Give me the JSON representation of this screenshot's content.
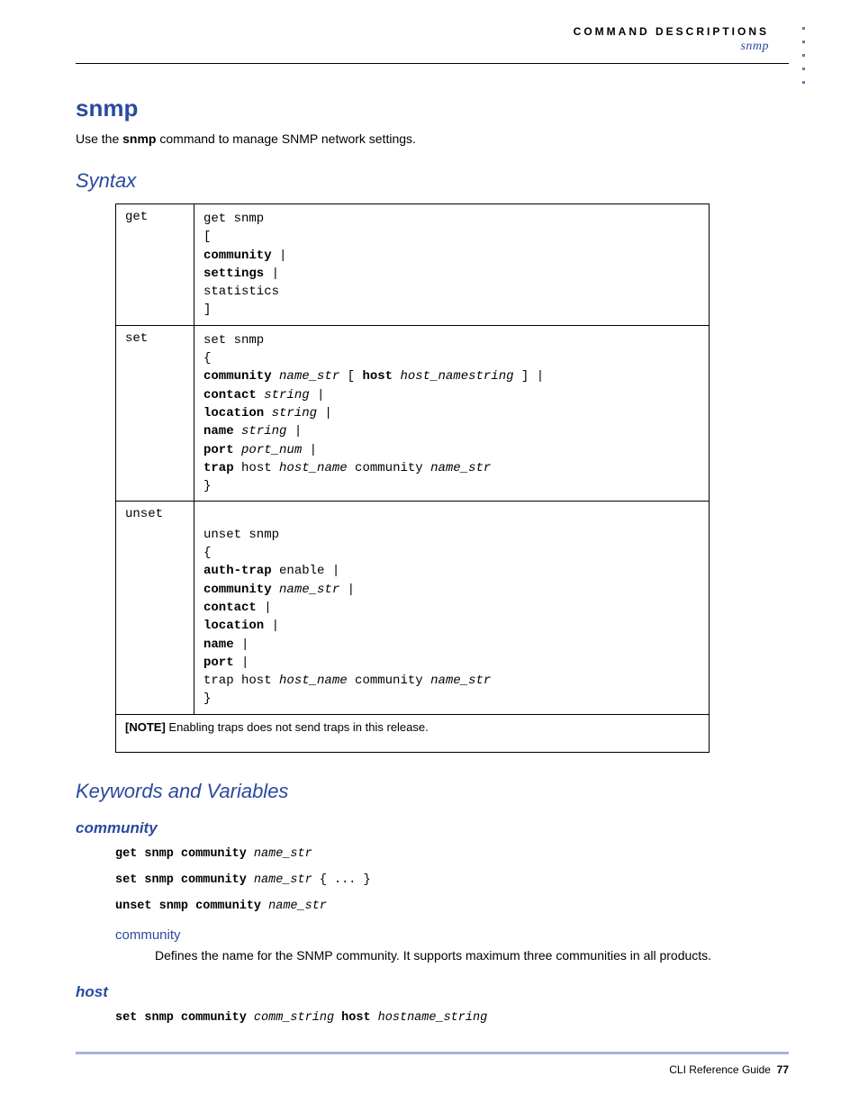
{
  "header": {
    "section": "COMMAND DESCRIPTIONS",
    "subsection": "snmp"
  },
  "title": "snmp",
  "intro_pre": "Use the ",
  "intro_cmd": "snmp",
  "intro_post": " command to manage SNMP network settings.",
  "syntax_heading": "Syntax",
  "syntax_rows": {
    "get": {
      "label": "get",
      "l1": "get snmp",
      "l2": "[",
      "l3": "community",
      "l3p": " |",
      "l4": "settings",
      "l4p": " |",
      "l5": "statistics",
      "l6": "]"
    },
    "set": {
      "label": "set",
      "l1": "set snmp",
      "l2": "{",
      "l3a": "community",
      "l3b": " name_str",
      "l3c": " [ ",
      "l3d": "host",
      "l3e": " host_namestring",
      "l3f": " ] |",
      "l4a": "contact",
      "l4b": " string",
      "l4p": " |",
      "l5a": "location",
      "l5b": " string",
      "l5p": " |",
      "l6a": "name",
      "l6b": " string",
      "l6p": " |",
      "l7a": "port",
      "l7b": " port_num",
      "l7p": " |",
      "l8a": "trap",
      "l8b": " host ",
      "l8c": "host_name",
      "l8d": " community ",
      "l8e": "name_str",
      "l9": "}"
    },
    "unset": {
      "label": "unset",
      "l1": "unset snmp",
      "l2": "{",
      "l3a": "auth-trap",
      "l3b": " enable |",
      "l4a": "community",
      "l4b": " name_str",
      "l4p": " |",
      "l5a": "contact",
      "l5p": " |",
      "l6a": "location",
      "l6p": " |",
      "l7a": "name",
      "l7p": " |",
      "l8a": "port",
      "l8p": " |",
      "l9a": "trap host ",
      "l9b": "host_name",
      "l9c": " community ",
      "l9d": "name_str",
      "l10": "}"
    }
  },
  "note_label": "[NOTE]",
  "note_text": " Enabling traps does not send traps in this release.",
  "kv_heading": "Keywords and Variables",
  "community": {
    "head": "community",
    "c1a": "get snmp community",
    "c1b": " name_str",
    "c2a": "set snmp community",
    "c2b": " name_str",
    "c2c": " { ... }",
    "c3a": "unset snmp community",
    "c3b": " name_str",
    "sub": "community",
    "desc": "Defines the name for the SNMP community. It supports maximum three communities in all products."
  },
  "host": {
    "head": "host",
    "c1a": "set snmp community",
    "c1b": " comm_string",
    "c1c": " host",
    "c1d": " hostname_string"
  },
  "footer": {
    "text": "CLI Reference Guide",
    "page": "77"
  }
}
